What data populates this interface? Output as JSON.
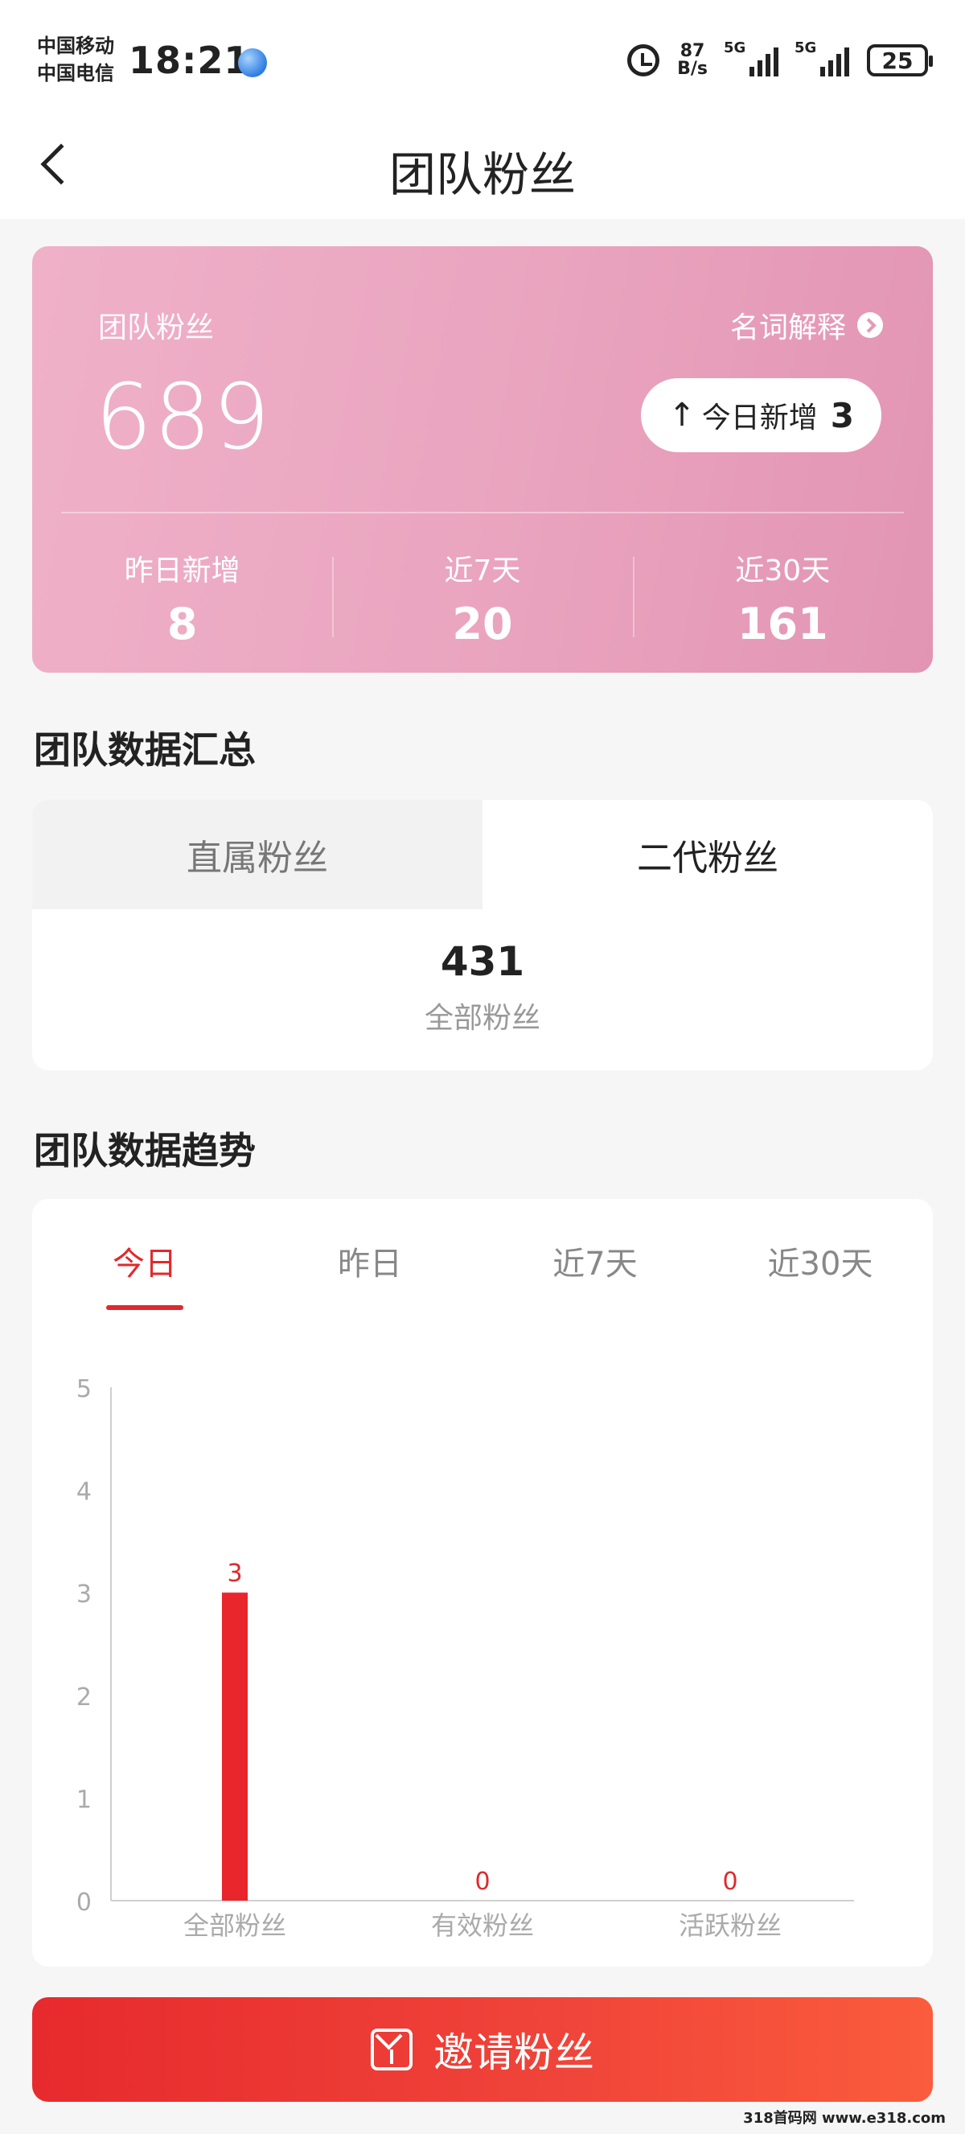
{
  "status_bar": {
    "carrier_1": "中国移动",
    "carrier_2": "中国电信",
    "time": "18:21",
    "net_speed_value": "87",
    "net_speed_unit": "B/s",
    "signal_1": "5G",
    "signal_2": "5G",
    "battery": "25"
  },
  "nav": {
    "title": "团队粉丝"
  },
  "fans_card": {
    "label": "团队粉丝",
    "explain_link": "名词解释",
    "total": "689",
    "today_label": "今日新增",
    "today_value": "3",
    "stats": [
      {
        "label": "昨日新增",
        "value": "8"
      },
      {
        "label": "近7天",
        "value": "20"
      },
      {
        "label": "近30天",
        "value": "161"
      }
    ]
  },
  "summary": {
    "title": "团队数据汇总",
    "tabs": [
      {
        "label": "直属粉丝",
        "active": false
      },
      {
        "label": "二代粉丝",
        "active": true
      }
    ],
    "value": "431",
    "caption": "全部粉丝"
  },
  "trend": {
    "title": "团队数据趋势",
    "tabs": [
      {
        "label": "今日",
        "active": true
      },
      {
        "label": "昨日",
        "active": false
      },
      {
        "label": "近7天",
        "active": false
      },
      {
        "label": "近30天",
        "active": false
      }
    ]
  },
  "chart_data": {
    "type": "bar",
    "categories": [
      "全部粉丝",
      "有效粉丝",
      "活跃粉丝"
    ],
    "values": [
      3,
      0,
      0
    ],
    "ylim": [
      0,
      5
    ],
    "yticks": [
      "0",
      "1",
      "2",
      "3",
      "4",
      "5"
    ],
    "data_labels": [
      "3",
      "0",
      "0"
    ],
    "bar_color": "#e8262b",
    "label_color": "#e0292e"
  },
  "invite_button": {
    "label": "邀请粉丝"
  },
  "watermark": "318首码网 www.e318.com"
}
